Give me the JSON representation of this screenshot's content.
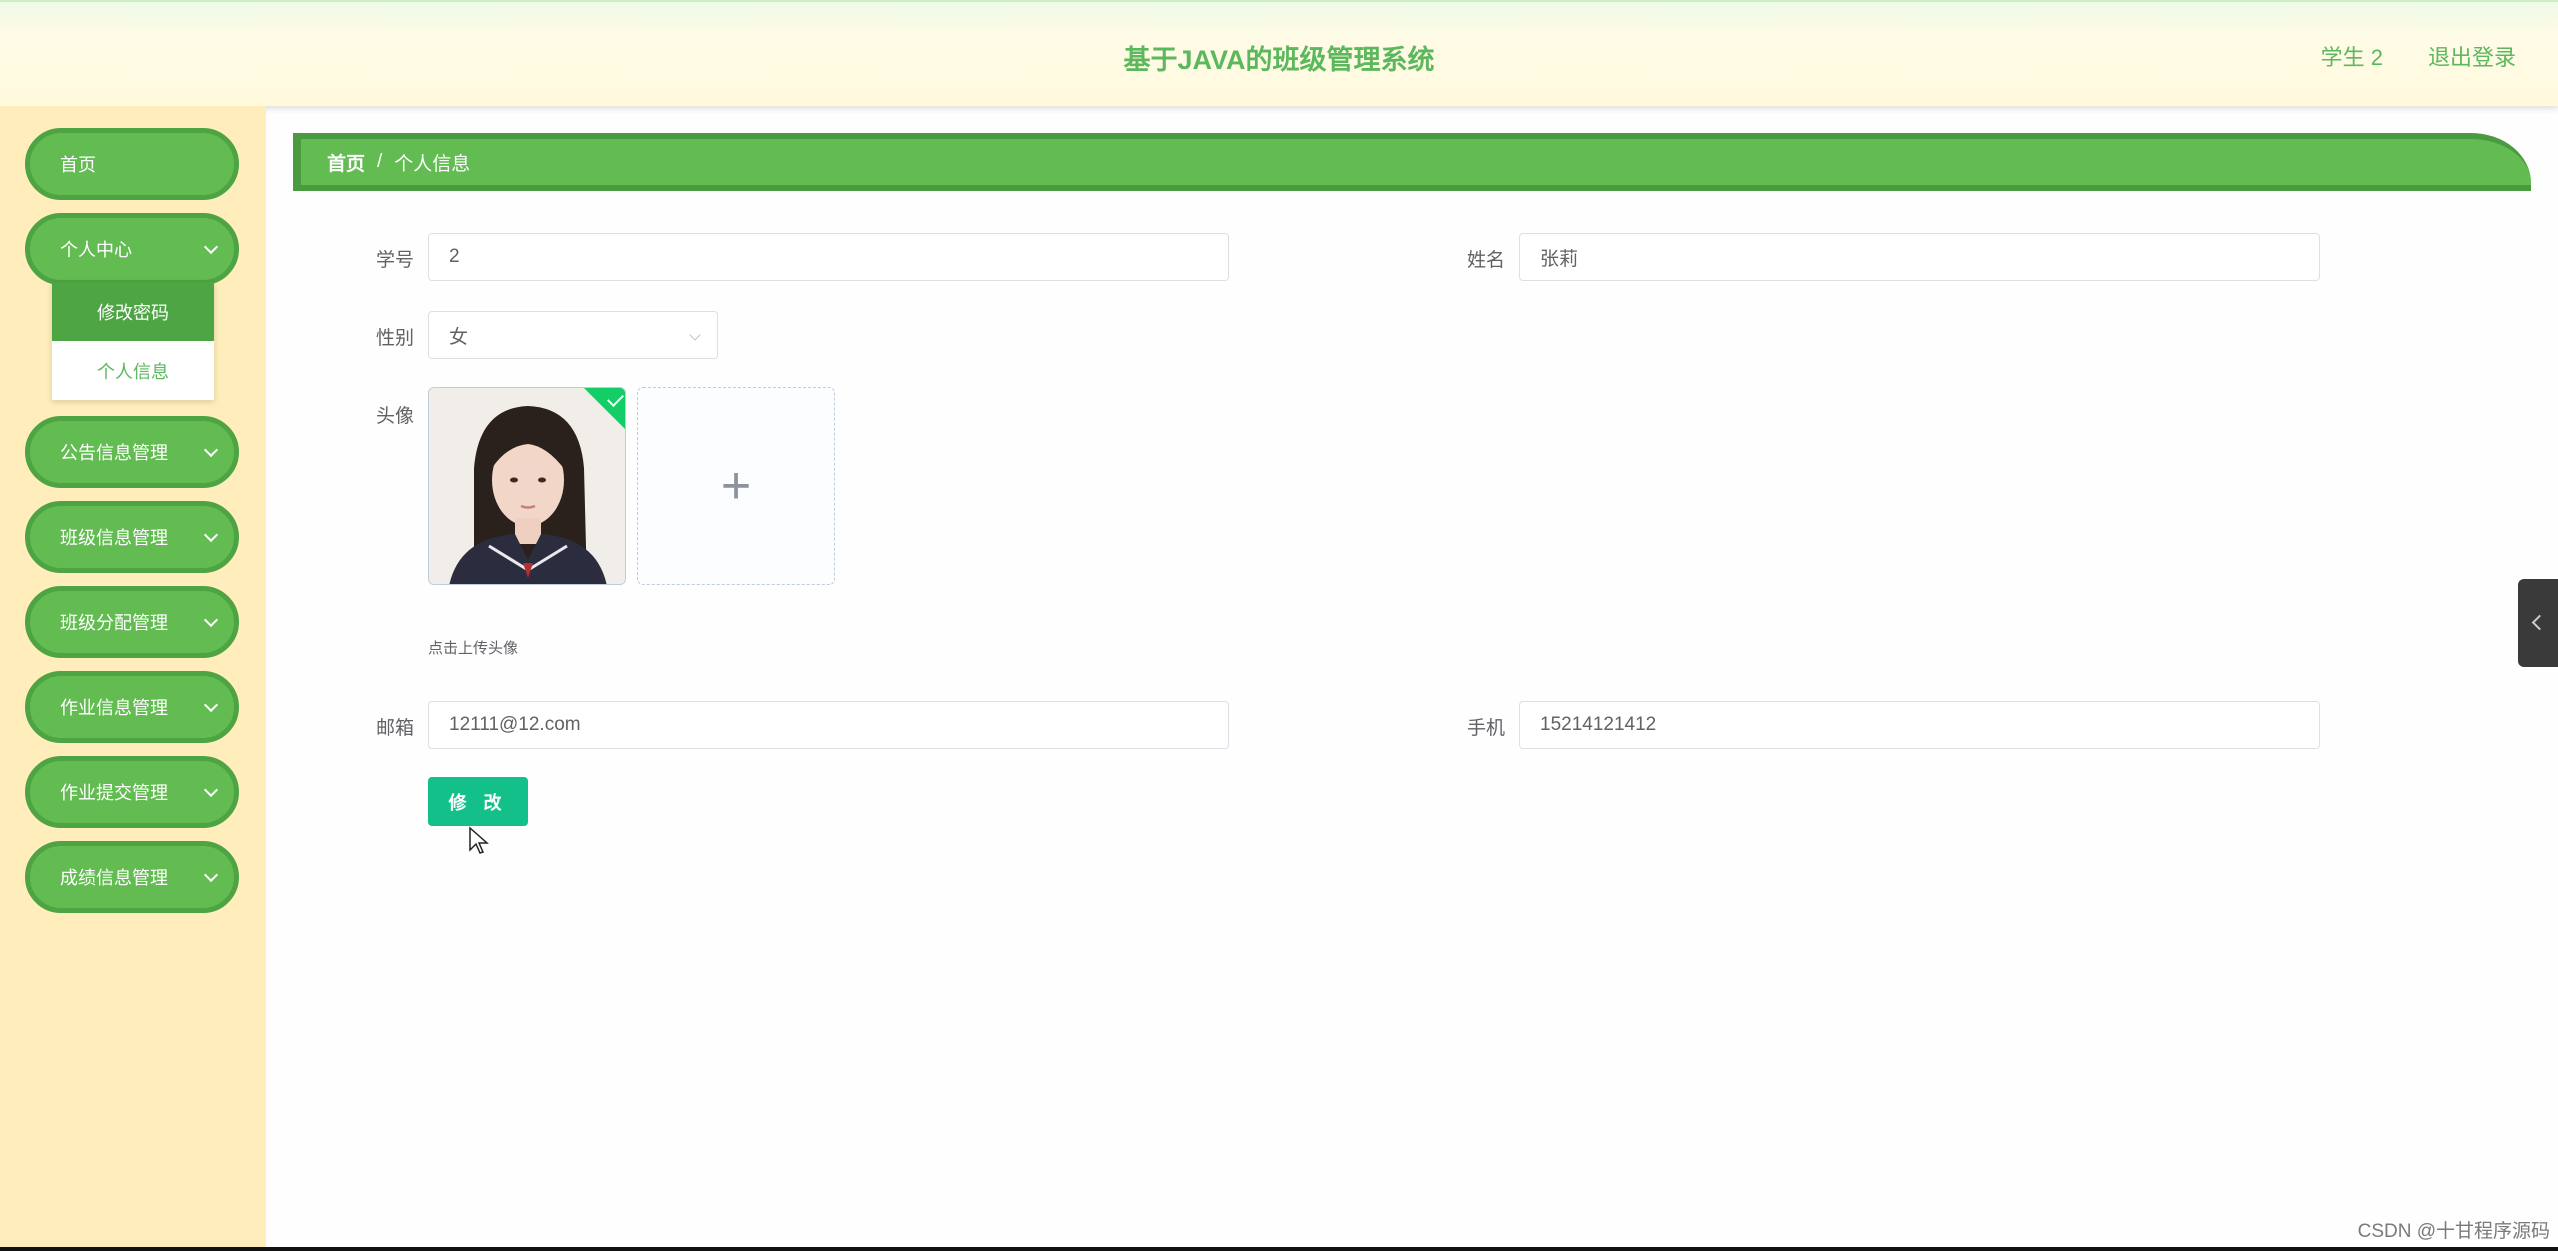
{
  "header": {
    "title": "基于JAVA的班级管理系统",
    "user": "学生 2",
    "logout": "退出登录"
  },
  "sidebar": {
    "items": [
      {
        "label": "首页"
      },
      {
        "label": "个人中心"
      },
      {
        "label": "公告信息管理"
      },
      {
        "label": "班级信息管理"
      },
      {
        "label": "班级分配管理"
      },
      {
        "label": "作业信息管理"
      },
      {
        "label": "作业提交管理"
      },
      {
        "label": "成绩信息管理"
      }
    ],
    "submenu": [
      {
        "label": "修改密码"
      },
      {
        "label": "个人信息"
      }
    ]
  },
  "breadcrumb": {
    "home": "首页",
    "separator": "/",
    "current": "个人信息"
  },
  "form": {
    "student_id": {
      "label": "学号",
      "value": "2"
    },
    "name": {
      "label": "姓名",
      "value": "张莉"
    },
    "gender": {
      "label": "性别",
      "value": "女"
    },
    "avatar": {
      "label": "头像",
      "tip": "点击上传头像",
      "upload_icon": "plus-icon"
    },
    "email": {
      "label": "邮箱",
      "value": "12111@12.com"
    },
    "phone": {
      "label": "手机",
      "value": "15214121412"
    },
    "submit": "修 改"
  },
  "watermark": "CSDN @十甘程序源码",
  "colors": {
    "accent_green": "#62bc52",
    "button_teal": "#13c08a",
    "sidebar_bg": "#ffeebb"
  }
}
